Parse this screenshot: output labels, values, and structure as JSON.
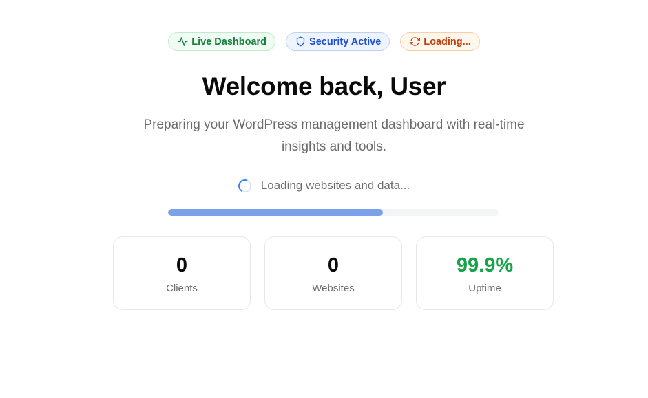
{
  "badges": {
    "live": {
      "label": "Live Dashboard",
      "icon": "activity-icon",
      "color": "#15803d"
    },
    "security": {
      "label": "Security Active",
      "icon": "shield-icon",
      "color": "#1d4ed8"
    },
    "loading": {
      "label": "Loading...",
      "icon": "refresh-icon",
      "color": "#c2410c"
    }
  },
  "header": {
    "title": "Welcome back, User",
    "subtitle": "Preparing your WordPress management dashboard with real-time insights and tools."
  },
  "status": {
    "text": "Loading websites and data...",
    "progress": 0.65,
    "progress_color": "#7ba1ea"
  },
  "stats": [
    {
      "value": "0",
      "label": "Clients"
    },
    {
      "value": "0",
      "label": "Websites"
    },
    {
      "value": "99.9%",
      "label": "Uptime",
      "color": "#16a34a"
    }
  ]
}
